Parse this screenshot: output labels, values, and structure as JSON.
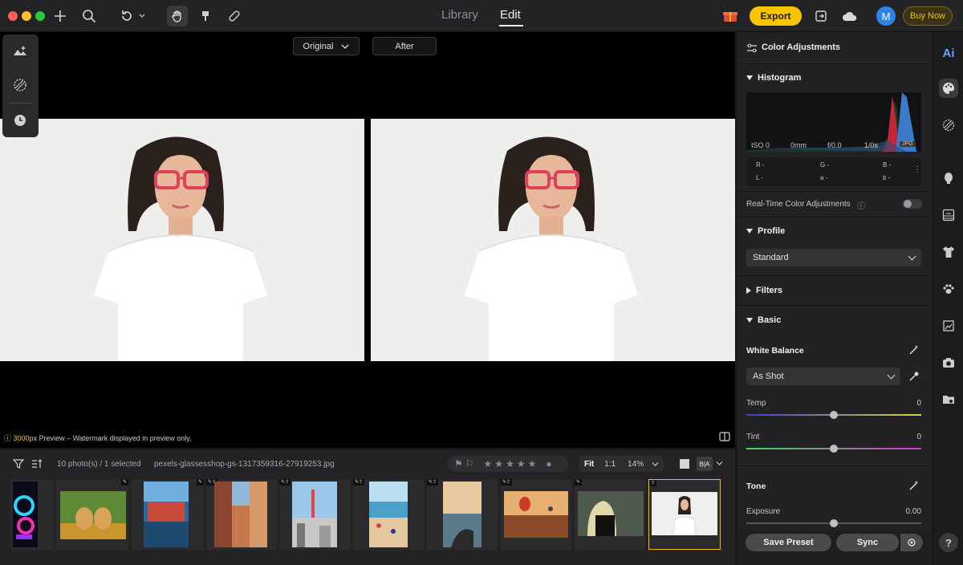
{
  "tabs": {
    "library": "Library",
    "edit": "Edit"
  },
  "toolbar": {
    "export_label": "Export",
    "buy_label": "Buy Now",
    "avatar_initial": "M"
  },
  "view": {
    "original_label": "Original",
    "after_label": "After"
  },
  "preview_note": {
    "size": "3000",
    "rest": "px Preview – Watermark displayed in preview only."
  },
  "filmstrip": {
    "count_text": "10 photo(s) / 1 selected",
    "filename": "pexels-glassesshop-gs-1317359316-27919253.jpg",
    "fit_label": "Fit",
    "one_to_one": "1:1",
    "zoom": "14%",
    "ba_label": "B|A"
  },
  "panel": {
    "title": "Color Adjustments",
    "histogram_title": "Histogram",
    "exif": {
      "iso": "ISO 0",
      "focal": "0mm",
      "aperture": "f/0.0",
      "shutter": "1/0s",
      "format": "JPG"
    },
    "readout": {
      "r": "R -",
      "g": "G -",
      "b": "B -",
      "l": "L -",
      "a": "a -",
      "bb": "b -"
    },
    "realtime_label": "Real-Time Color Adjustments",
    "profile_title": "Profile",
    "profile_value": "Standard",
    "filters_title": "Filters",
    "basic_title": "Basic",
    "wb_title": "White Balance",
    "wb_value": "As Shot",
    "temp_label": "Temp",
    "temp_value": "0",
    "tint_label": "Tint",
    "tint_value": "0",
    "tone_title": "Tone",
    "exposure_label": "Exposure",
    "exposure_value": "0.00",
    "save_preset": "Save Preset",
    "sync": "Sync"
  },
  "rail": {
    "ai_label": "Ai",
    "help_label": "?"
  },
  "colors": {
    "accent": "#f7c400",
    "window_bg": "#1c1c1e",
    "panel_bg": "#222224",
    "avatar": "#2b84e8"
  }
}
